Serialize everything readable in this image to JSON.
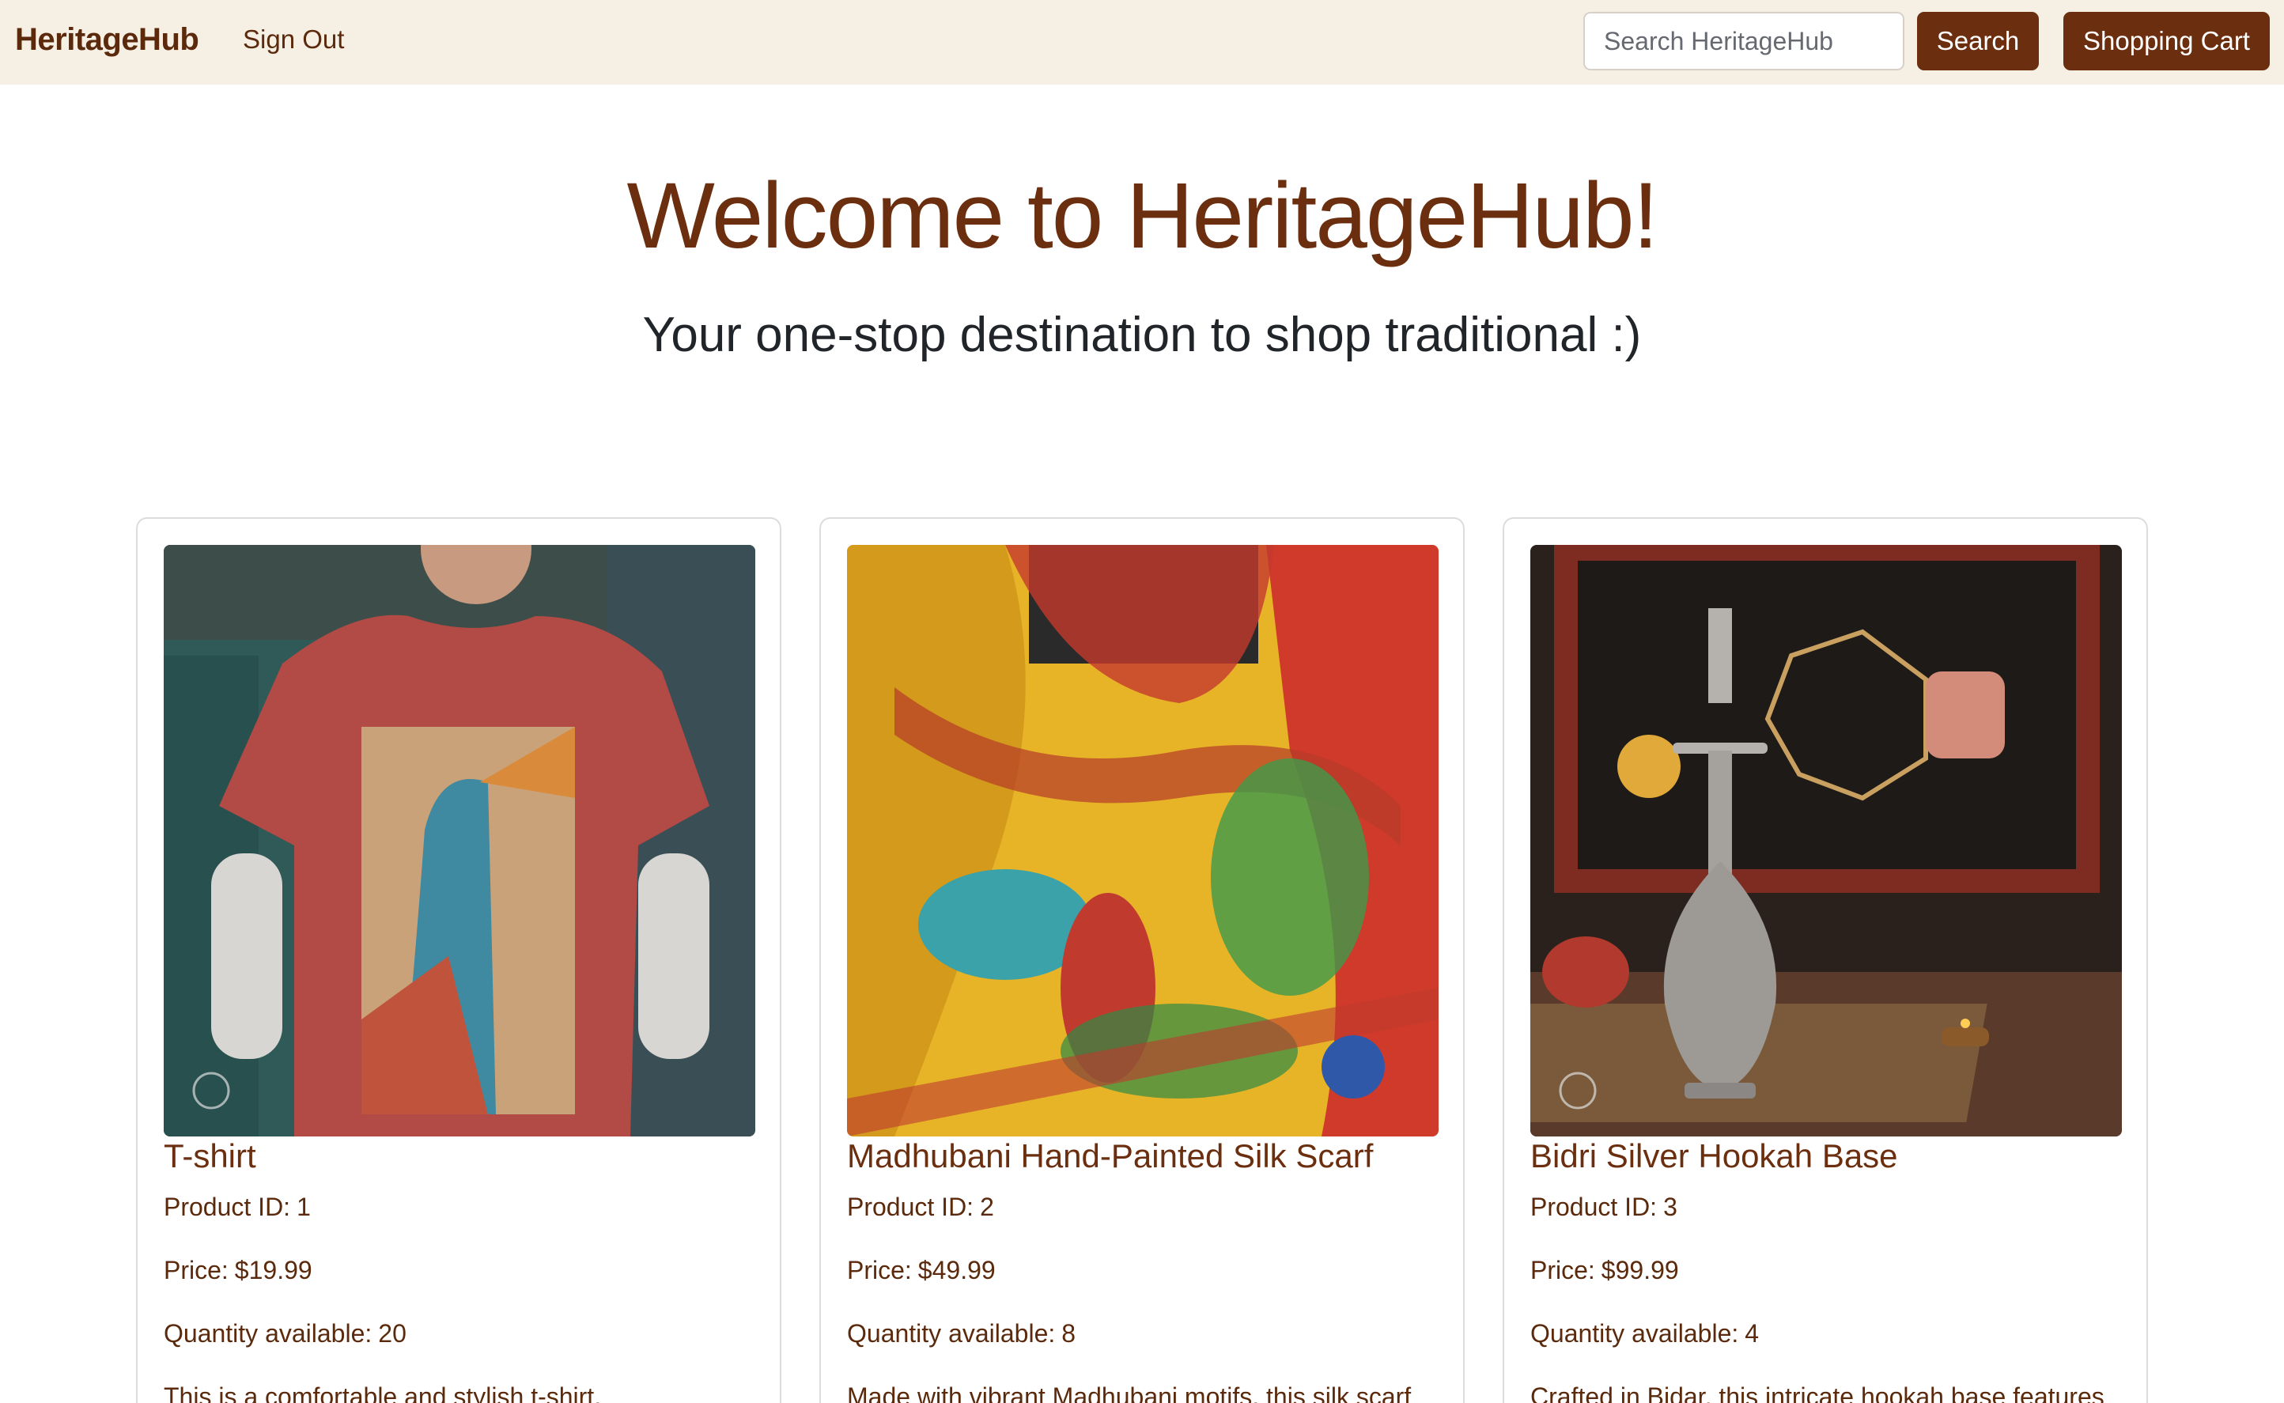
{
  "navbar": {
    "brand": "HeritageHub",
    "sign_out": "Sign Out",
    "search_placeholder": "Search HeritageHub",
    "search_button": "Search",
    "cart_button": "Shopping Cart"
  },
  "hero": {
    "title": "Welcome to HeritageHub!",
    "subtitle": "Your one-stop destination to shop traditional :)"
  },
  "labels": {
    "product_id": "Product ID:",
    "price": "Price:",
    "quantity": "Quantity available:"
  },
  "products": [
    {
      "name": "T-shirt",
      "id": "1",
      "price": "$19.99",
      "quantity": "20",
      "description": "This is a comfortable and stylish t-shirt."
    },
    {
      "name": "Madhubani Hand-Painted Silk Scarf",
      "id": "2",
      "price": "$49.99",
      "quantity": "8",
      "description": "Made with vibrant Madhubani motifs, this silk scarf"
    },
    {
      "name": "Bidri Silver Hookah Base",
      "id": "3",
      "price": "$99.99",
      "quantity": "4",
      "description": "Crafted in Bidar, this intricate hookah base features"
    }
  ],
  "colors": {
    "navbar_bg": "#f6efe4",
    "brand": "#5b2a0c",
    "button_bg": "#6b2e0e",
    "hero_title": "#6b2e0e",
    "subtitle": "#212529"
  }
}
